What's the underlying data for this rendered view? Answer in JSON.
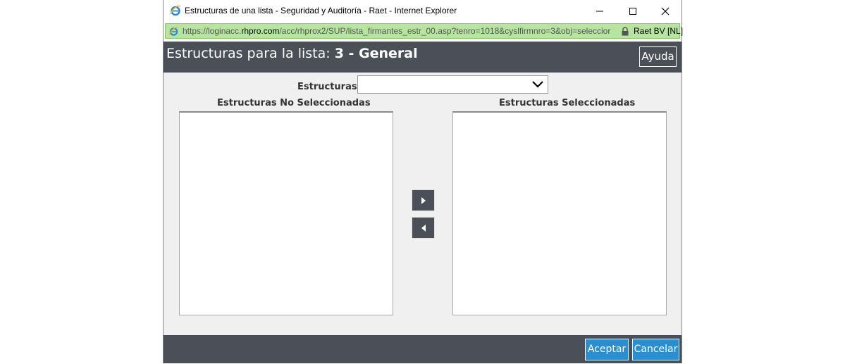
{
  "window": {
    "title": "Estructuras de una lista - Seguridad y Auditoría - Raet - Internet Explorer",
    "controls": {
      "minimize": "minimize-icon",
      "maximize": "maximize-icon",
      "close": "close-icon"
    }
  },
  "address_bar": {
    "url_prefix": "https://loginacc.",
    "url_domain": "rhpro.com",
    "url_path": "/acc/rhprox2/SUP/lista_firmantes_estr_00.asp?tenro=1018&cyslfirmnro=3&obj=seleccior",
    "certificate": "Raet BV [NL]"
  },
  "header": {
    "title_prefix": "Estructuras para la lista: ",
    "title_bold": "3 - General",
    "help_button": "Ayuda"
  },
  "form": {
    "estructuras_label": "Estructuras:",
    "estructuras_value": ""
  },
  "lists": {
    "left_title": "Estructuras No Seleccionadas",
    "right_title": "Estructuras Seleccionadas",
    "left_items": [],
    "right_items": []
  },
  "footer": {
    "accept_label": "Aceptar",
    "cancel_label": "Cancelar"
  },
  "colors": {
    "header_bg": "#4b4f58",
    "button_blue": "#2a8fd0",
    "address_green": "#b7e59f",
    "content_bg": "#f0f0f0"
  }
}
